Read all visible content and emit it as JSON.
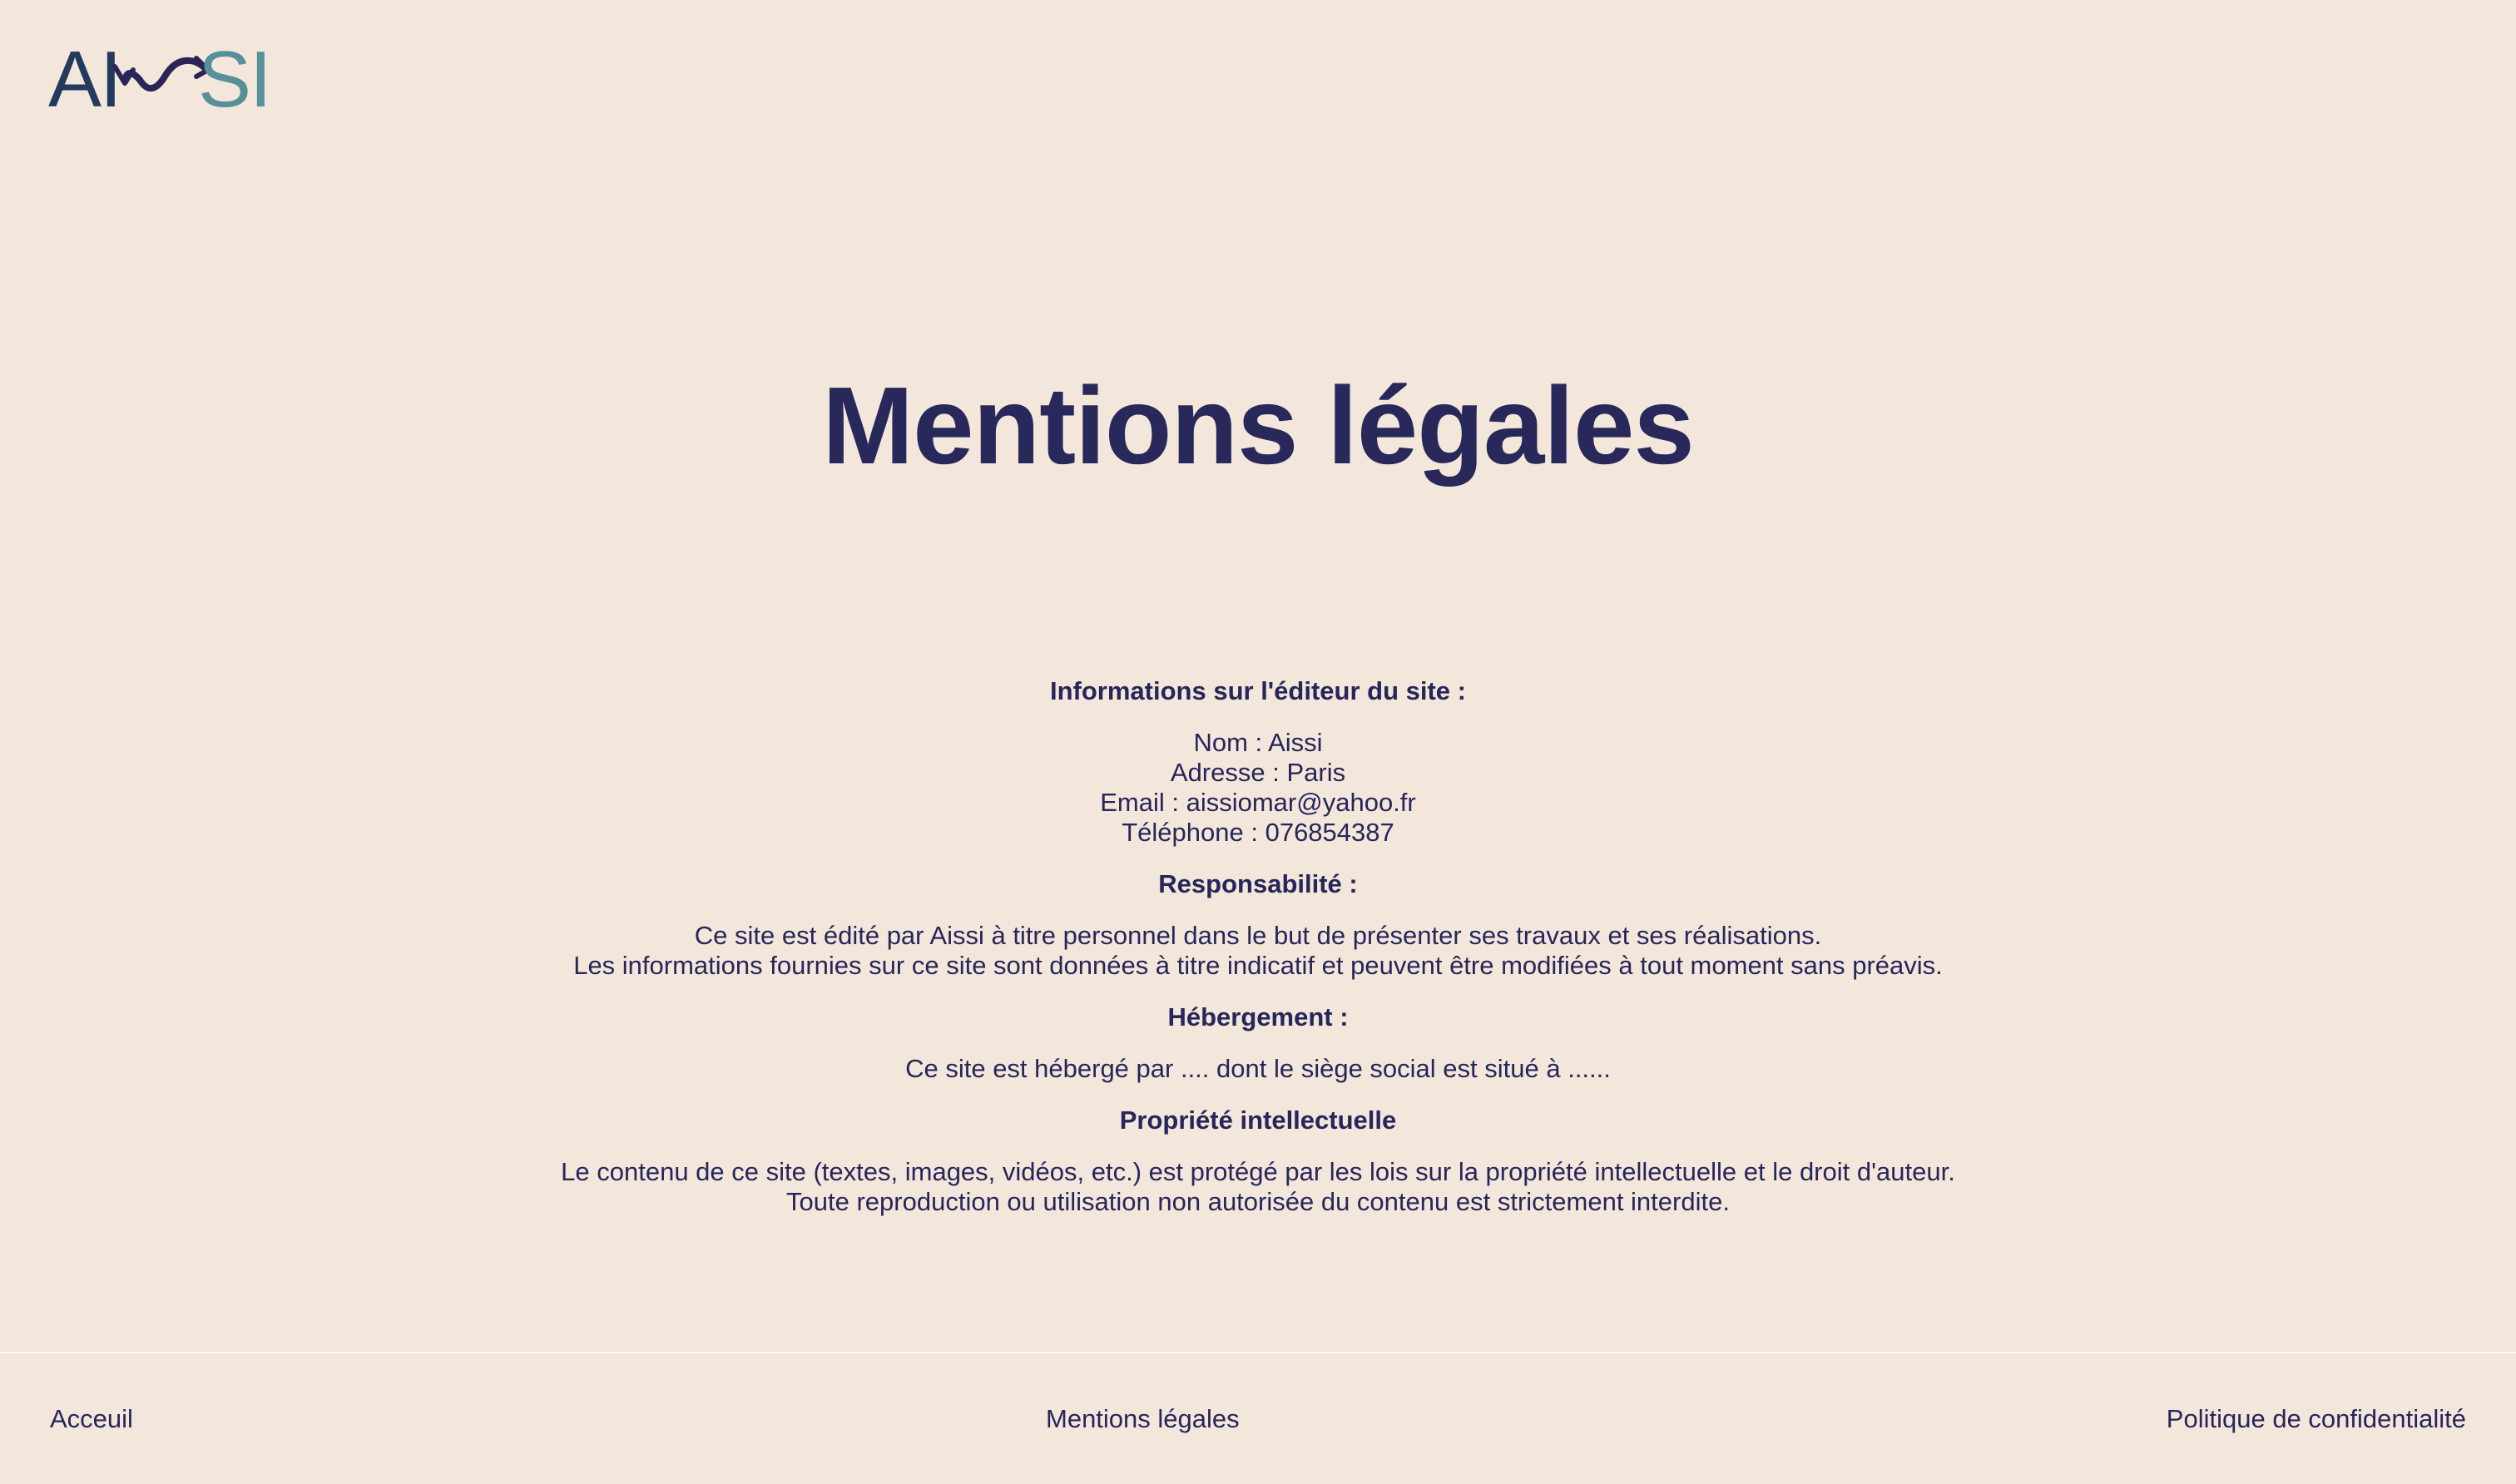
{
  "logo": {
    "text_left": "AI",
    "text_right": "SI",
    "colors": {
      "dark": "#233a5e",
      "purple": "#2b2457",
      "teal": "#57909a"
    }
  },
  "page": {
    "title": "Mentions légales"
  },
  "sections": [
    {
      "heading": "Informations sur l'éditeur du site :",
      "lines": [
        "Nom : Aissi",
        "Adresse : Paris",
        "Email : aissiomar@yahoo.fr",
        "Téléphone : 076854387"
      ]
    },
    {
      "heading": "Responsabilité :",
      "lines": [
        "Ce site est édité par Aissi à titre personnel dans le but de présenter ses travaux et ses réalisations.",
        "Les informations fournies sur ce site sont données à titre indicatif et peuvent être modifiées à tout moment sans préavis."
      ]
    },
    {
      "heading": "Hébergement :",
      "lines": [
        "Ce site est hébergé par .... dont le siège social est situé à ......"
      ]
    },
    {
      "heading": "Propriété intellectuelle",
      "lines": [
        "Le contenu de ce site (textes, images, vidéos, etc.) est protégé par les lois sur la propriété intellectuelle et le droit d'auteur.",
        "Toute reproduction ou utilisation non autorisée du contenu est strictement interdite."
      ]
    }
  ],
  "footer": {
    "home": "Acceuil",
    "legal": "Mentions légales",
    "privacy": "Politique de confidentialité"
  },
  "colors": {
    "background": "#f3e7db",
    "text": "#27255a"
  }
}
